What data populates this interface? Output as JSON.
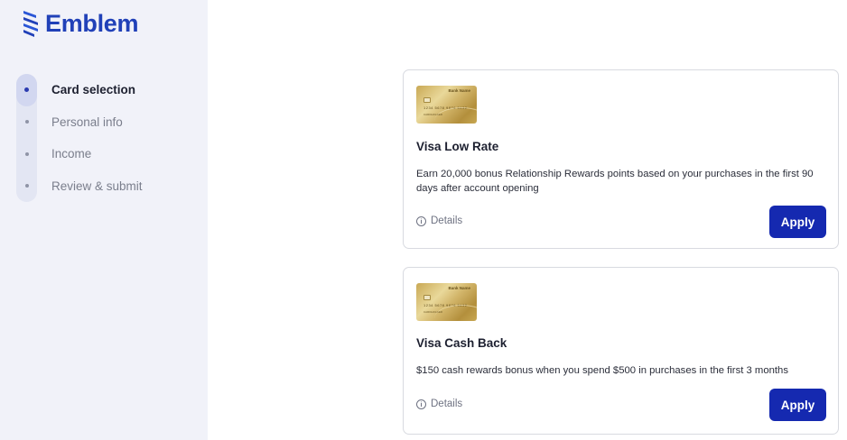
{
  "brand": {
    "name": "Emblem",
    "color": "#2141b8"
  },
  "steps": [
    {
      "label": "Card selection",
      "active": true
    },
    {
      "label": "Personal info",
      "active": false
    },
    {
      "label": "Income",
      "active": false
    },
    {
      "label": "Review & submit",
      "active": false
    }
  ],
  "cards": [
    {
      "image": {
        "bank_name": "Bank Name",
        "number": "1234 5678 9876 5432",
        "holder": "CARDHOLDER"
      },
      "title": "Visa Low Rate",
      "description": "Earn 20,000 bonus Relationship Rewards points based on your purchases in the first 90 days after account opening",
      "details_label": "Details",
      "apply_label": "Apply"
    },
    {
      "image": {
        "bank_name": "Bank Name",
        "number": "1234 5678 9876 5432",
        "holder": "CARDHOLDER"
      },
      "title": "Visa Cash Back",
      "description": "$150 cash rewards bonus when you spend $500 in purchases in the first 3 months",
      "details_label": "Details",
      "apply_label": "Apply"
    }
  ],
  "icons": {
    "logo": "emblem-logo-icon",
    "details": "info-icon"
  },
  "colors": {
    "sidebar_bg": "#f1f2f9",
    "primary_button": "#1529b0",
    "active_step": "#d2d7f0"
  }
}
